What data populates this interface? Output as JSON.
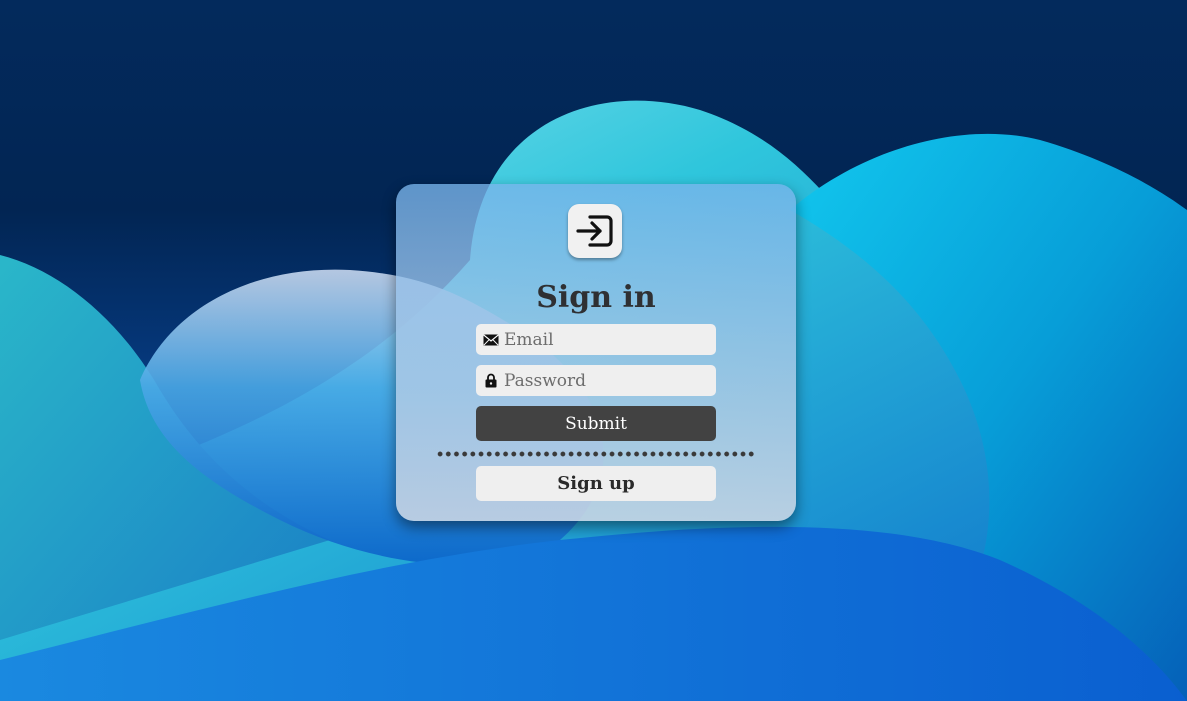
{
  "login": {
    "title": "Sign in",
    "email": {
      "placeholder": "Email",
      "icon": "envelope-icon"
    },
    "password": {
      "placeholder": "Password",
      "icon": "lock-icon"
    },
    "submit_label": "Submit",
    "signup_label": "Sign up",
    "logo_icon": "sign-in-icon"
  },
  "colors": {
    "submit_bg": "#424242",
    "field_bg": "#efefef",
    "title_text": "#2f3033"
  }
}
